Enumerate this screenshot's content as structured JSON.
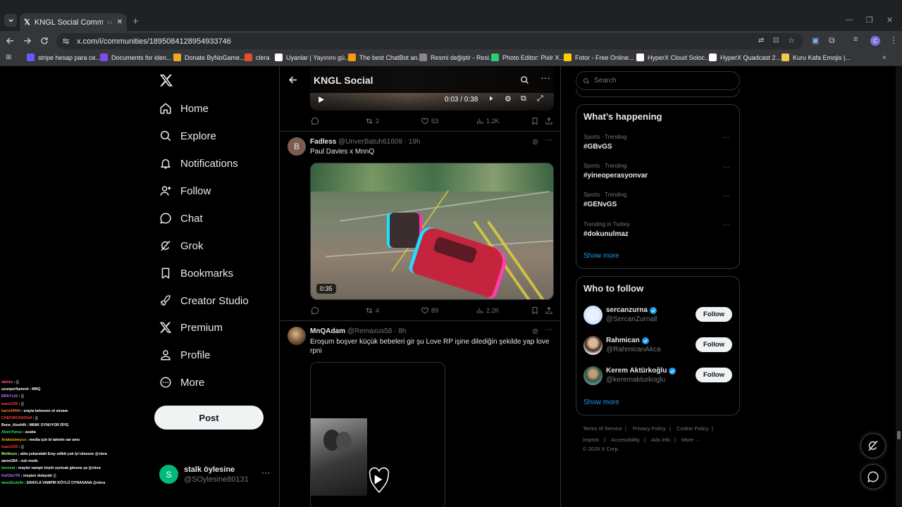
{
  "browser": {
    "tab_title": "KNGL Social Community / X",
    "url": "x.com/i/communities/1895084128954933746",
    "avatar_letter": "C"
  },
  "bookmarks": [
    {
      "label": "stripe hesap para ce...",
      "color": "#635bff"
    },
    {
      "label": "Documents for iden...",
      "color": "#7b4ee8"
    },
    {
      "label": "Donate ByNoGame...",
      "color": "#f5a623"
    },
    {
      "label": "clera",
      "color": "#e0502a"
    },
    {
      "label": "Uyanlar | Yayınını gü...",
      "color": "#ffffff"
    },
    {
      "label": "The best ChatBot an...",
      "color": "#f39c12"
    },
    {
      "label": "Resmi değiştir - Resi...",
      "color": "#888888"
    },
    {
      "label": "Photo Editor: Pixlr X...",
      "color": "#2ecc71"
    },
    {
      "label": "Fotor - Free Online...",
      "color": "#ffcc00"
    },
    {
      "label": "HyperX Cloud Soloc...",
      "color": "#ffffff"
    },
    {
      "label": "HyperX Quadcast 2...",
      "color": "#ffffff"
    },
    {
      "label": "Kuru Kafa Emojis |...",
      "color": "#f2c94c"
    }
  ],
  "nav": {
    "items": [
      {
        "label": "Home",
        "icon": "home-icon"
      },
      {
        "label": "Explore",
        "icon": "search-icon"
      },
      {
        "label": "Notifications",
        "icon": "bell-icon"
      },
      {
        "label": "Follow",
        "icon": "person-plus-icon"
      },
      {
        "label": "Chat",
        "icon": "chat-bubble-icon"
      },
      {
        "label": "Grok",
        "icon": "grok-icon"
      },
      {
        "label": "Bookmarks",
        "icon": "bookmark-icon"
      },
      {
        "label": "Creator Studio",
        "icon": "rocket-icon"
      },
      {
        "label": "Premium",
        "icon": "x-logo-icon"
      },
      {
        "label": "Profile",
        "icon": "person-icon"
      },
      {
        "label": "More",
        "icon": "more-circle-icon"
      }
    ],
    "post_label": "Post"
  },
  "account": {
    "avatar_letter": "S",
    "name": "stalk öylesine",
    "handle": "@SOylesine80131"
  },
  "chat_overlay": [
    {
      "name": "",
      "msg": "",
      "color": "#a970ff"
    },
    {
      "name": "dalmis",
      "msg": ": ▒",
      "color": "#ff4fa3"
    },
    {
      "name": "uzunperfiament",
      "msg": ": MNQ",
      "color": "#ffffff"
    },
    {
      "name": "BRKYx32",
      "msg": ": ▒",
      "color": "#c16bff"
    },
    {
      "name": "kaan1330",
      "msg": ": ▒",
      "color": "#ff3b3b"
    },
    {
      "name": "baris44444",
      "msg": ": erayla bekenrm of stream",
      "color": "#ff7a1a"
    },
    {
      "name": "CHEFWICKEDfeff",
      "msg": ": ▒",
      "color": "#ff3b3b"
    },
    {
      "name": "Bone_AizehiN",
      "msg": ": MINIK OYNUYOR DİYE",
      "color": "#ffffff"
    },
    {
      "name": "AlzenYunus",
      "msg": ": acaba",
      "color": "#2ee86b"
    },
    {
      "name": "Arakstzmeyco",
      "msg": ": media için bi tahmin var amo",
      "color": "#ffb300"
    },
    {
      "name": "kaan1330",
      "msg": ": ▒",
      "color": "#ff3b3b"
    },
    {
      "name": "Melihozn",
      "msg": ": abla yukarıdaki Eray edildi çok iyi izleeene @clera",
      "color": "#b5ff6b"
    },
    {
      "name": "aaron354",
      "msg": ": sub mode",
      "color": "#ffffff"
    },
    {
      "name": "bevevat",
      "msg": ": erayler vampir köylü oynicak gitsene ya @clera",
      "color": "#2ee86b"
    },
    {
      "name": "Kal1SerTR",
      "msg": ": moşten dolayıdır ▒",
      "color": "#c16bff"
    },
    {
      "name": "tansdGutelle",
      "msg": ": ERAYLA VAMPIR KÖYLÜ OYNASANA @clera",
      "color": "#2ee86b"
    }
  ],
  "community": {
    "title": "KNGL Social"
  },
  "video_top": {
    "time": "0:03 / 0:38"
  },
  "post1_stats": {
    "reposts": "2",
    "likes": "53",
    "views": "1.2K"
  },
  "post2": {
    "avatar_letter": "B",
    "name": "Fadless",
    "handle": "@UnverBatuh61609",
    "dot": "·",
    "time": "19h",
    "text": "Paul Davies x MnnQ",
    "duration": "0:35",
    "stats": {
      "reposts": "4",
      "likes": "89",
      "views": "2.2K"
    }
  },
  "post3": {
    "name": "MnQAdam",
    "handle": "@Remaxus58",
    "dot": "·",
    "time": "8h",
    "text": "Eroşum boşver küçük bebeleri gir şu Love RP işine dilediğin şekilde yap love rpni"
  },
  "search": {
    "placeholder": "Search"
  },
  "trends": {
    "title": "What’s happening",
    "items": [
      {
        "meta": "Sports · Trending",
        "tag": "#GBvGS"
      },
      {
        "meta": "Sports · Trending",
        "tag": "#yineoperasyonvar"
      },
      {
        "meta": "Sports · Trending",
        "tag": "#GENvGS"
      },
      {
        "meta": "Trending in Turkey",
        "tag": "#dokunulmaz"
      }
    ],
    "show_more": "Show more"
  },
  "who_to_follow": {
    "title": "Who to follow",
    "items": [
      {
        "name": "sercanzurna",
        "handle": "@SercanZurnall",
        "button": "Follow"
      },
      {
        "name": "Rahmican",
        "handle": "@RahmicanAkca",
        "button": "Follow"
      },
      {
        "name": "Kerem Aktürkoğlu",
        "handle": "@keremakturkoglu",
        "button": "Follow"
      }
    ],
    "show_more": "Show more"
  },
  "footer": {
    "links": [
      "Terms of Service",
      "Privacy Policy",
      "Cookie Policy",
      "Imprint",
      "Accessibility",
      "Ads info",
      "More ···"
    ],
    "copyright": "© 2026 X Corp."
  },
  "colors": {
    "accent": "#1d9bf0",
    "verified": "#1d9bf0",
    "muted": "#71767b",
    "border": "#2f3336"
  }
}
